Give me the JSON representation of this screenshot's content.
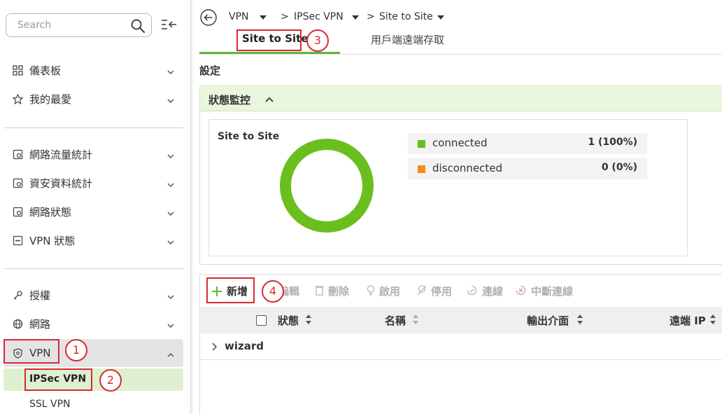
{
  "sidebar": {
    "search_placeholder": "Search",
    "items": [
      {
        "label": "儀表板",
        "icon": "dashboard-icon"
      },
      {
        "label": "我的最愛",
        "icon": "star-icon"
      },
      {
        "label": "網路流量統計",
        "icon": "traffic-stats-icon"
      },
      {
        "label": "資安資料統計",
        "icon": "security-stats-icon"
      },
      {
        "label": "網路狀態",
        "icon": "network-status-icon"
      },
      {
        "label": "VPN 狀態",
        "icon": "vpn-status-icon"
      },
      {
        "label": "授權",
        "icon": "key-icon"
      },
      {
        "label": "網路",
        "icon": "globe-icon"
      },
      {
        "label": "VPN",
        "icon": "shield-icon"
      }
    ],
    "sub_items": [
      "IPSec VPN",
      "SSL VPN"
    ]
  },
  "breadcrumb": [
    "VPN",
    "IPSec VPN",
    "Site to Site"
  ],
  "tabs": [
    "Site to Site",
    "用戶端遠端存取"
  ],
  "section_title": "設定",
  "status_panel": {
    "title": "狀態監控",
    "card_title": "Site to Site",
    "legend": [
      {
        "name": "connected",
        "value": "1 (100%)",
        "color": "#6abf1e"
      },
      {
        "name": "disconnected",
        "value": "0 (0%)",
        "color": "#f58a1f"
      }
    ]
  },
  "toolbar": {
    "add": "新增",
    "edit": "編輯",
    "delete": "刪除",
    "enable": "啟用",
    "disable": "停用",
    "connect": "連線",
    "disconnect": "中斷連線"
  },
  "table": {
    "headers": [
      "狀態",
      "名稱",
      "輸出介面",
      "遠端 IP"
    ],
    "rows": [
      {
        "label": "wizard"
      }
    ]
  },
  "annotations": [
    "1",
    "2",
    "3",
    "4"
  ],
  "colors": {
    "accent": "#6abf1e",
    "highlight": "#d82a32"
  }
}
